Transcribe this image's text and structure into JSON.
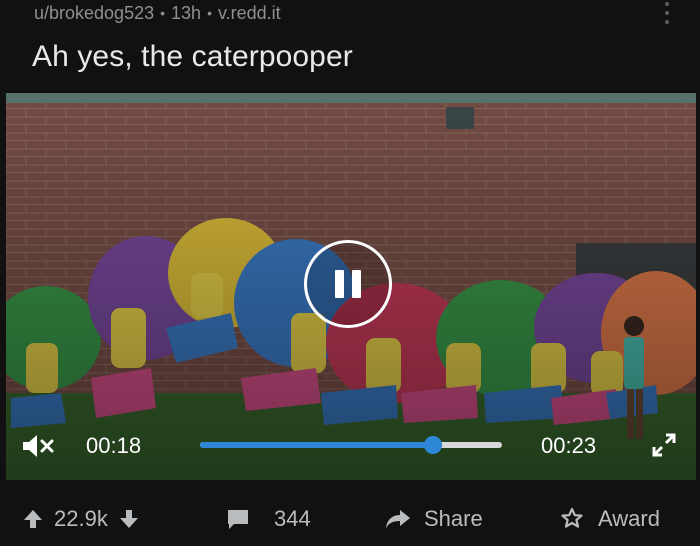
{
  "post": {
    "author": "u/brokedog523",
    "age": "13h",
    "domain": "v.redd.it",
    "title": "Ah yes, the caterpooper"
  },
  "player": {
    "current_time": "00:18",
    "duration": "00:23",
    "progress": 0.77,
    "state": "playing",
    "muted": true,
    "accent_color": "#2d87d6"
  },
  "actions": {
    "upvotes": "22.9k",
    "comments": "344",
    "share_label": "Share",
    "award_label": "Award"
  },
  "icons": [
    "more-icon",
    "pause-icon",
    "mute-icon",
    "fullscreen-icon",
    "upvote-icon",
    "downvote-icon",
    "comment-icon",
    "share-icon",
    "award-icon"
  ]
}
